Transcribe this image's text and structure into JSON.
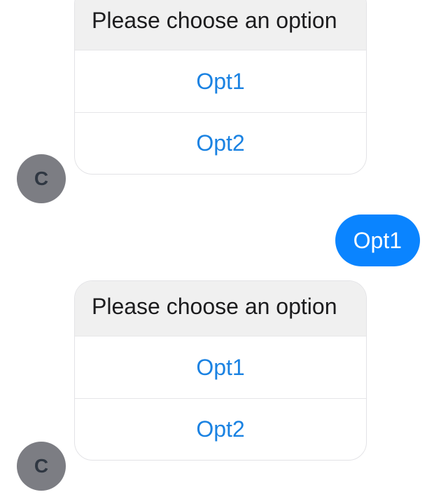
{
  "conversation": {
    "bot_avatar_initial": "C",
    "messages": [
      {
        "sender": "bot",
        "prompt": "Please choose an option",
        "options": [
          "Opt1",
          "Opt2"
        ]
      },
      {
        "sender": "user",
        "text": "Opt1"
      },
      {
        "sender": "bot",
        "prompt": "Please choose an option",
        "options": [
          "Opt1",
          "Opt2"
        ]
      }
    ]
  },
  "colors": {
    "user_bubble": "#0a84ff",
    "option_link": "#1a82e2",
    "card_header_bg": "#f0f0f0",
    "avatar_bg": "#7c7d83"
  }
}
